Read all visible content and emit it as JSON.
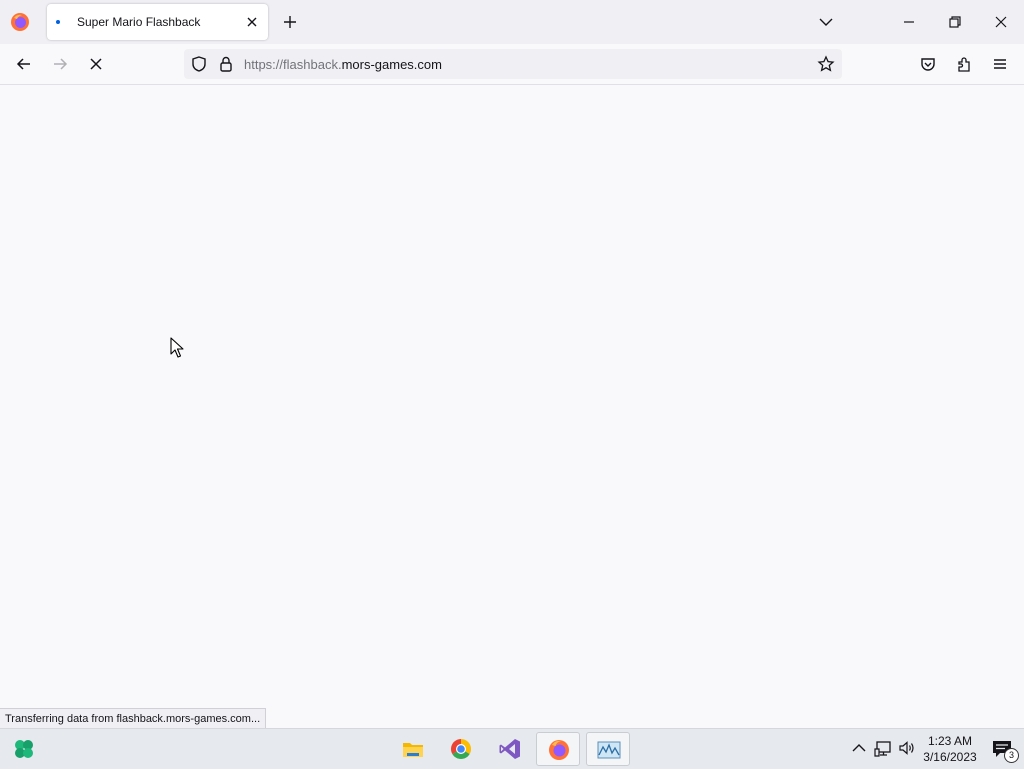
{
  "browser": {
    "tab": {
      "title": "Super Mario Flashback"
    },
    "url": {
      "scheme_prefix": "https://flashback.",
      "host": "mors-games.com"
    },
    "status_text": "Transferring data from flashback.mors-games.com..."
  },
  "icons": {
    "tabbar": [
      "firefox-logo-icon",
      "tab-loading-dot-icon",
      "close-tab-icon",
      "new-tab-icon",
      "list-all-tabs-icon",
      "minimize-icon",
      "restore-icon",
      "close-window-icon"
    ],
    "navbar": [
      "back-icon",
      "forward-icon",
      "stop-loading-icon",
      "tracking-protection-icon",
      "lock-icon",
      "bookmark-star-icon",
      "pocket-icon",
      "extensions-icon",
      "menu-icon"
    ]
  },
  "taskbar": {
    "apps": [
      "start-icon",
      "file-explorer-icon",
      "chrome-icon",
      "visual-studio-icon",
      "firefox-icon",
      "monitor-app-icon"
    ],
    "tray": [
      "show-hidden-icons",
      "network-icon",
      "volume-icon"
    ],
    "clock": {
      "time": "1:23 AM",
      "date": "3/16/2023"
    },
    "notifications": {
      "count": "3"
    }
  },
  "colors": {
    "accent": "#0060df",
    "chrome": "#f0f0f4",
    "page": "#f9f9fb",
    "taskbar": "#e6e9ee"
  }
}
